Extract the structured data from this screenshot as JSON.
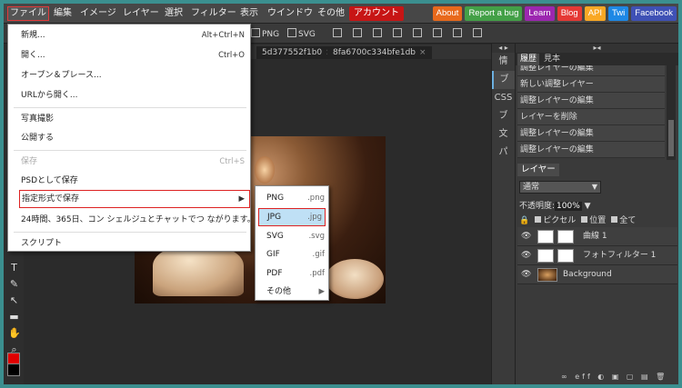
{
  "menubar": {
    "items": [
      {
        "label": "ファイル"
      },
      {
        "label": "編集"
      },
      {
        "label": "イメージ"
      },
      {
        "label": "レイヤー"
      },
      {
        "label": "選択"
      },
      {
        "label": "フィルター"
      },
      {
        "label": "表示"
      },
      {
        "label": "ウインドウ"
      },
      {
        "label": "その他"
      }
    ],
    "account": "アカウント"
  },
  "links": [
    {
      "label": "About",
      "color": "#e8691c"
    },
    {
      "label": "Report a bug",
      "color": "#43a047"
    },
    {
      "label": "Learn",
      "color": "#9c27b0"
    },
    {
      "label": "Blog",
      "color": "#e53935"
    },
    {
      "label": "API",
      "color": "#f9a825"
    },
    {
      "label": "Twi",
      "color": "#1e88e5"
    },
    {
      "label": "Facebook",
      "color": "#3f51b5"
    }
  ],
  "toolbar": {
    "png": "PNG",
    "svg": "SVG"
  },
  "tabs": [
    {
      "label": "5d377552f1b0",
      "close": "×"
    },
    {
      "label": "8fa6700c334bfe1db",
      "close": "×"
    }
  ],
  "file_menu": {
    "new": {
      "label": "新規...",
      "shortcut": "Alt+Ctrl+N"
    },
    "open": {
      "label": "開く...",
      "shortcut": "Ctrl+O"
    },
    "open_place": {
      "label": "オープン＆プレース..."
    },
    "open_url": {
      "label": "URLから開く..."
    },
    "take_photo": {
      "label": "写真撮影"
    },
    "publish": {
      "label": "公開する"
    },
    "save": {
      "label": "保存",
      "shortcut": "Ctrl+S"
    },
    "save_psd": {
      "label": "PSDとして保存"
    },
    "export_as": {
      "label": "指定形式で保存",
      "arrow": "▶"
    },
    "concierge": {
      "label": "24時間、365日、コン シェルジュとチャットでつ ながります。..."
    },
    "script": {
      "label": "スクリプト"
    }
  },
  "export_submenu": [
    {
      "label": "PNG",
      "ext": ".png"
    },
    {
      "label": "JPG",
      "ext": ".jpg"
    },
    {
      "label": "SVG",
      "ext": ".svg"
    },
    {
      "label": "GIF",
      "ext": ".gif"
    },
    {
      "label": "PDF",
      "ext": ".pdf"
    },
    {
      "label": "その他",
      "ext": "▶"
    }
  ],
  "side_column": {
    "collapse": "◂ ▸",
    "items": [
      "情",
      "ブ",
      "CSS",
      "ブ",
      "文",
      "パ"
    ]
  },
  "right_panel": {
    "collapse": "▸◂",
    "tabs": [
      "履歴",
      "見本"
    ],
    "history": [
      "調整レイヤーの編集",
      "新しい調整レイヤー",
      "調整レイヤーの編集",
      "レイヤーを削除",
      "調整レイヤーの編集",
      "調整レイヤーの編集"
    ],
    "layers_tab": "レイヤー",
    "blend_mode": "通常",
    "opacity_label": "不透明度:",
    "opacity_value": "100%",
    "lock_label": "🔒",
    "lock_pixel": "ピクセル",
    "lock_position": "位置",
    "lock_all": "全て",
    "layers": [
      {
        "name": "曲線 1"
      },
      {
        "name": "フォトフィルター 1"
      },
      {
        "name": "Background"
      }
    ],
    "bottom_icons": "∞ eff ◐ ▣ ▢ ▤ 🗑"
  }
}
